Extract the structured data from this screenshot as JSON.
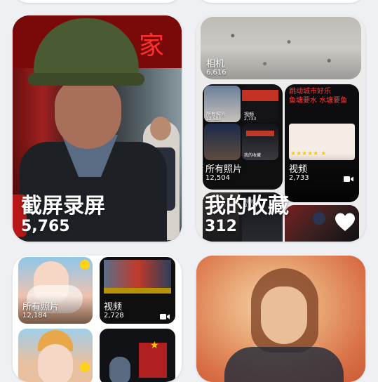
{
  "albums": [
    {
      "id": "screenshots",
      "title": "截屏录屏",
      "count": "5,765"
    },
    {
      "id": "favorites",
      "title": "我的收藏",
      "count": "312",
      "preview": {
        "camera": {
          "label": "相机",
          "count": "6,616"
        },
        "all_photos": {
          "label": "所有照片",
          "count": "12,504"
        },
        "video": {
          "label": "视频",
          "count": "2,733",
          "headline": "跳动城市好乐\n鱼塘要水 水塘要鱼"
        },
        "small_all": {
          "label": "所有照片",
          "count": "12,503"
        },
        "small_video": {
          "label": "视频",
          "count": "2,733"
        },
        "small_fav": {
          "label": "我的收藏"
        },
        "small_video2": {
          "label": "视频",
          "count": "2,733"
        }
      }
    },
    {
      "id": "multi",
      "preview": {
        "all_photos": {
          "label": "所有照片",
          "count": "12,184"
        },
        "video": {
          "label": "视频",
          "count": "2,728"
        }
      }
    },
    {
      "id": "portrait"
    }
  ],
  "colors": {
    "page_bg": "#eef0f4",
    "text_on_image": "#ffffff",
    "accent_red": "#ff3b3b"
  },
  "icons": {
    "favorite": "heart-icon",
    "video": "video-camera-icon"
  }
}
